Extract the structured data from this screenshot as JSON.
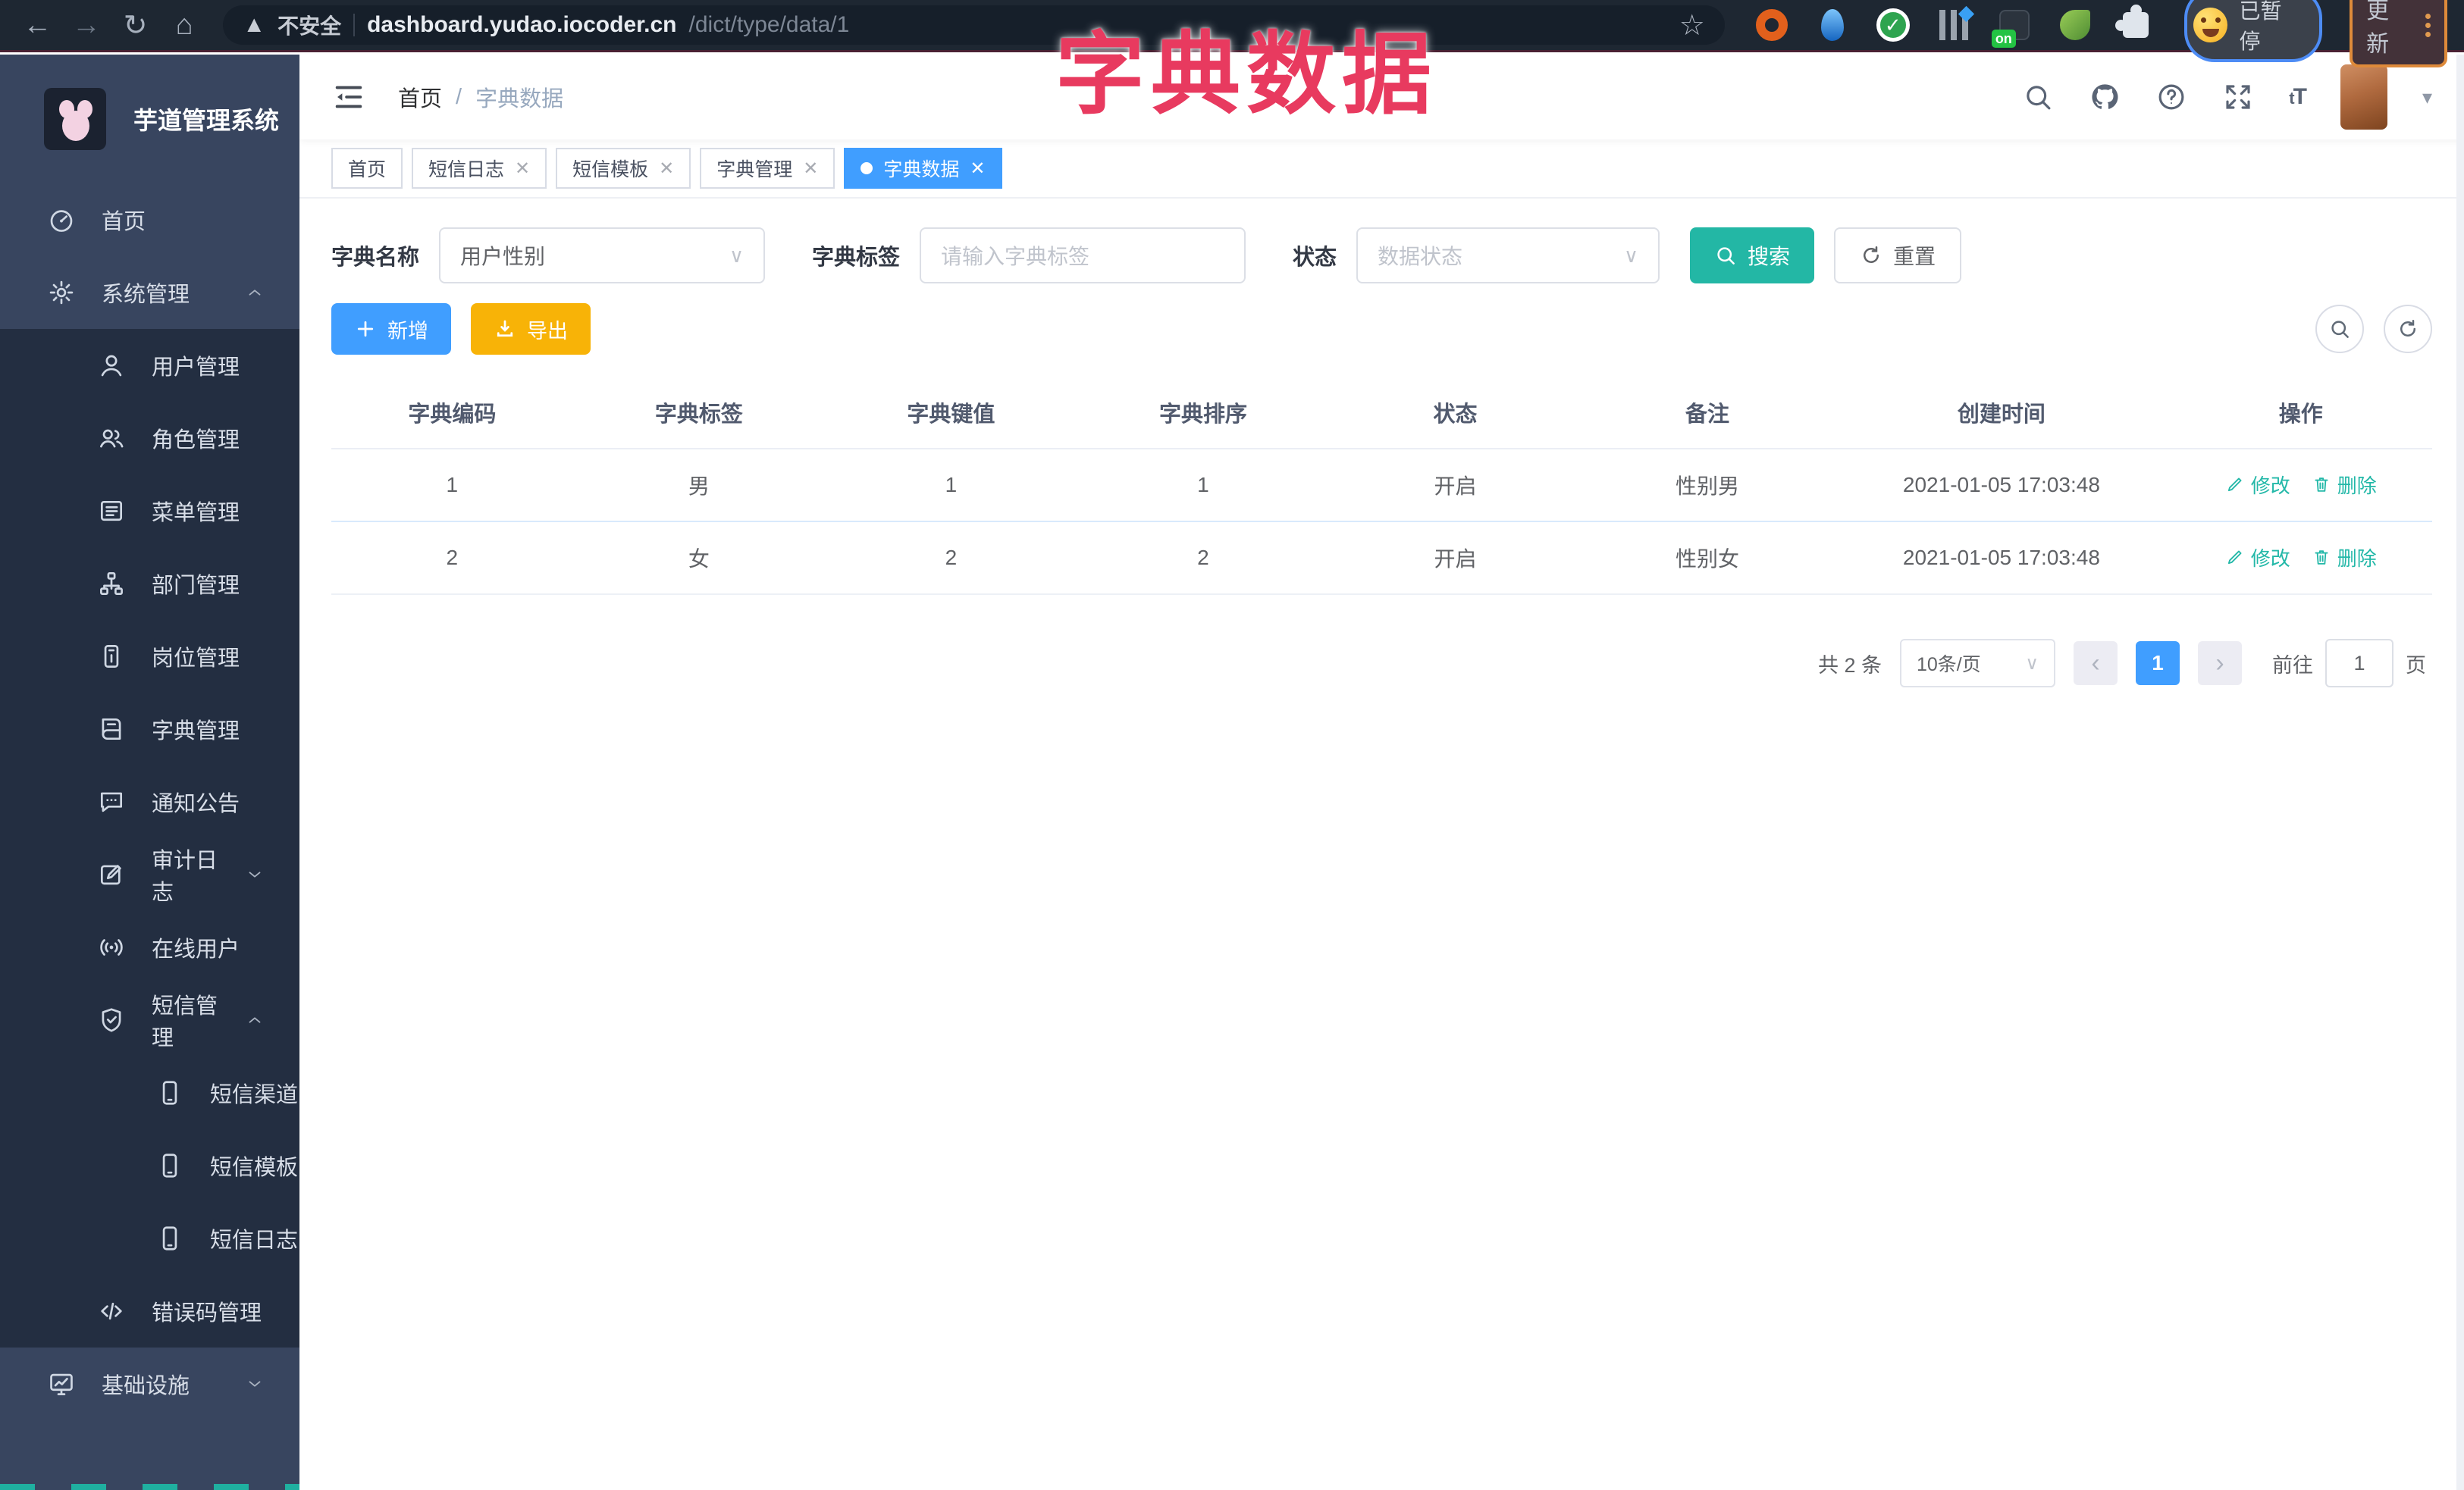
{
  "browser": {
    "security_label": "不安全",
    "url_host": "dashboard.yudao.iocoder.cn",
    "url_path": "/dict/type/data/1",
    "extension_on_badge": "on",
    "paused_label": "已暂停",
    "update_label": "更新"
  },
  "overlay_title": "字典数据",
  "sidebar": {
    "logo_title": "芋道管理系统",
    "items": [
      {
        "label": "首页",
        "icon": "dashboard",
        "level": 0,
        "chevron": ""
      },
      {
        "label": "系统管理",
        "icon": "gear",
        "level": 0,
        "chevron": "up"
      },
      {
        "label": "用户管理",
        "icon": "user",
        "level": 1,
        "chevron": ""
      },
      {
        "label": "角色管理",
        "icon": "users",
        "level": 1,
        "chevron": ""
      },
      {
        "label": "菜单管理",
        "icon": "list",
        "level": 1,
        "chevron": ""
      },
      {
        "label": "部门管理",
        "icon": "tree",
        "level": 1,
        "chevron": ""
      },
      {
        "label": "岗位管理",
        "icon": "badge",
        "level": 1,
        "chevron": ""
      },
      {
        "label": "字典管理",
        "icon": "book",
        "level": 1,
        "chevron": ""
      },
      {
        "label": "通知公告",
        "icon": "comment",
        "level": 1,
        "chevron": ""
      },
      {
        "label": "审计日志",
        "icon": "edit",
        "level": 1,
        "chevron": "down"
      },
      {
        "label": "在线用户",
        "icon": "signal",
        "level": 1,
        "chevron": ""
      },
      {
        "label": "短信管理",
        "icon": "shield",
        "level": 1,
        "chevron": "up"
      },
      {
        "label": "短信渠道",
        "icon": "phone",
        "level": 2,
        "chevron": ""
      },
      {
        "label": "短信模板",
        "icon": "phone",
        "level": 2,
        "chevron": ""
      },
      {
        "label": "短信日志",
        "icon": "phone",
        "level": 2,
        "chevron": ""
      },
      {
        "label": "错误码管理",
        "icon": "code",
        "level": 1,
        "chevron": ""
      },
      {
        "label": "基础设施",
        "icon": "monitor",
        "level": 0,
        "chevron": "down"
      }
    ]
  },
  "header": {
    "breadcrumb_home": "首页",
    "breadcrumb_separator": "/",
    "breadcrumb_current": "字典数据"
  },
  "tabs": [
    {
      "label": "首页",
      "closable": false,
      "active": false
    },
    {
      "label": "短信日志",
      "closable": true,
      "active": false
    },
    {
      "label": "短信模板",
      "closable": true,
      "active": false
    },
    {
      "label": "字典管理",
      "closable": true,
      "active": false
    },
    {
      "label": "字典数据",
      "closable": true,
      "active": true
    }
  ],
  "filters": {
    "dict_name_label": "字典名称",
    "dict_name_value": "用户性别",
    "dict_label_label": "字典标签",
    "dict_label_placeholder": "请输入字典标签",
    "status_label": "状态",
    "status_placeholder": "数据状态",
    "search_label": "搜索",
    "reset_label": "重置"
  },
  "toolbar": {
    "add_label": "新增",
    "export_label": "导出"
  },
  "table": {
    "headers": [
      "字典编码",
      "字典标签",
      "字典键值",
      "字典排序",
      "状态",
      "备注",
      "创建时间",
      "操作"
    ],
    "rows": [
      {
        "code": "1",
        "label": "男",
        "value": "1",
        "sort": "1",
        "status": "开启",
        "remark": "性别男",
        "created": "2021-01-05 17:03:48"
      },
      {
        "code": "2",
        "label": "女",
        "value": "2",
        "sort": "2",
        "status": "开启",
        "remark": "性别女",
        "created": "2021-01-05 17:03:48"
      }
    ],
    "edit_label": "修改",
    "delete_label": "删除"
  },
  "pagination": {
    "total_label": "共 2 条",
    "page_size_label": "10条/页",
    "current_page": "1",
    "goto_label": "前往",
    "goto_value": "1",
    "page_unit_label": "页"
  },
  "colors": {
    "accent": "#409eff",
    "teal": "#23b8a8",
    "export_yellow": "#f8b307",
    "overlay_red": "#e83a5f"
  }
}
